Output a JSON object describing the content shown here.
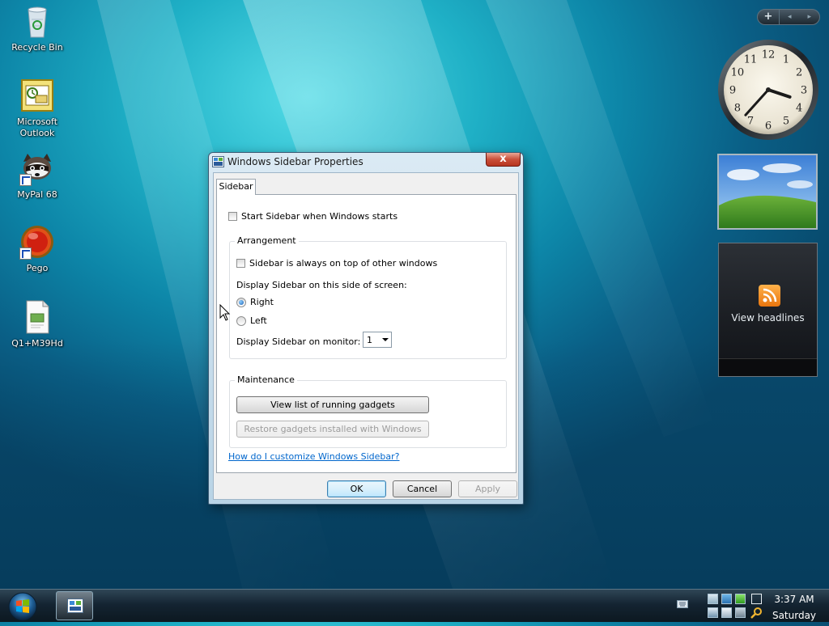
{
  "desktop": {
    "icons": [
      {
        "label": "Recycle Bin",
        "icon": "recycle-bin-icon"
      },
      {
        "label": "Microsoft Outlook",
        "icon": "outlook-icon"
      },
      {
        "label": "MyPal 68",
        "icon": "mypal-icon"
      },
      {
        "label": "Pego",
        "icon": "pego-icon"
      },
      {
        "label": "Q1+M39Hd",
        "icon": "document-icon"
      }
    ]
  },
  "sidebar": {
    "controls": {
      "add": "+",
      "prev": "◂",
      "next": "▸"
    },
    "clock": {
      "hour": 3,
      "minute": 37,
      "numerals": [
        "12",
        "1",
        "2",
        "3",
        "4",
        "5",
        "6",
        "7",
        "8",
        "9",
        "10",
        "11"
      ]
    },
    "feed": {
      "label": "View headlines"
    }
  },
  "dialog": {
    "title": "Windows Sidebar Properties",
    "close": "x",
    "tab": "Sidebar",
    "start_with_windows": {
      "label": "Start Sidebar when Windows starts",
      "checked": false
    },
    "arrangement": {
      "legend": "Arrangement",
      "always_on_top": {
        "label": "Sidebar is always on top of other windows",
        "checked": false
      },
      "side_prompt": "Display Sidebar on this side of screen:",
      "right": {
        "label": "Right",
        "selected": true
      },
      "left": {
        "label": "Left",
        "selected": false
      },
      "monitor_label": "Display Sidebar on monitor:",
      "monitor_value": "1"
    },
    "maintenance": {
      "legend": "Maintenance",
      "view_running": "View list of running gadgets",
      "restore": "Restore gadgets installed with Windows"
    },
    "help_link": "How do I customize Windows Sidebar?",
    "buttons": {
      "ok": "OK",
      "cancel": "Cancel",
      "apply": "Apply"
    }
  },
  "taskbar": {
    "time": "3:37 AM",
    "day": "Saturday",
    "colors": {
      "accent": "#1a5fb4",
      "link": "#0066cc"
    }
  }
}
